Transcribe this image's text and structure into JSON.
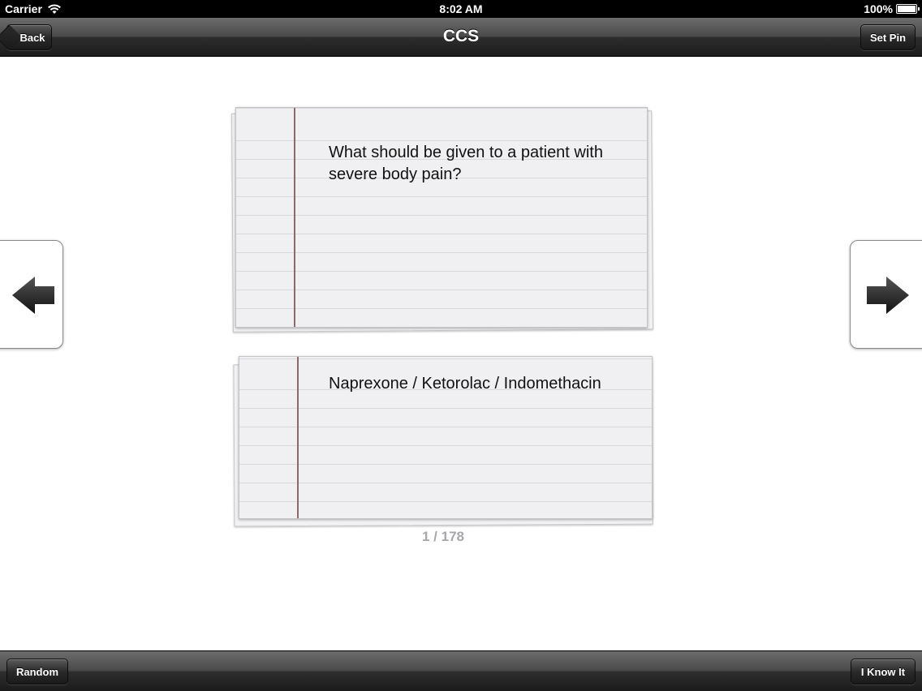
{
  "status_bar": {
    "carrier": "Carrier",
    "time": "8:02 AM",
    "battery": "100%",
    "battery_level": 1.0
  },
  "nav": {
    "title": "CCS",
    "back_label": "Back",
    "set_pin_label": "Set Pin"
  },
  "flashcard": {
    "question": "What should be given to a patient with severe body pain?",
    "answer": "Naprexone / Ketorolac / Indomethacin"
  },
  "counter": "1 / 178",
  "toolbar": {
    "random_label": "Random",
    "know_it_label": "I Know It"
  },
  "icons": {
    "wifi": "wifi-icon",
    "battery": "battery-icon",
    "prev": "arrow-left-icon",
    "next": "arrow-right-icon"
  },
  "colors": {
    "bar_dark": "#1c1c1c",
    "card_bg": "#f0f0f2",
    "card_margin_line": "#8c6a6a",
    "counter_text": "#a7a7ab"
  }
}
